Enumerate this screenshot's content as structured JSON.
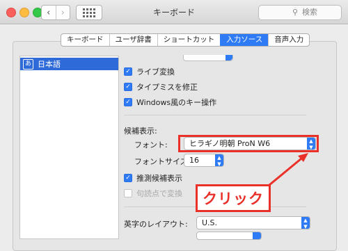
{
  "window": {
    "title": "キーボード",
    "back_glyph": "‹",
    "forward_glyph": "›",
    "search_placeholder": "検索",
    "search_icon_glyph": "⚲"
  },
  "tabs": [
    {
      "label": "キーボード",
      "active": false
    },
    {
      "label": "ユーザ辞書",
      "active": false
    },
    {
      "label": "ショートカット",
      "active": false
    },
    {
      "label": "入力ソース",
      "active": true
    },
    {
      "label": "音声入力",
      "active": false
    }
  ],
  "sidebar": {
    "items": [
      {
        "icon_text": "あ",
        "label": "日本語",
        "selected": true
      }
    ]
  },
  "options": {
    "live_conversion": {
      "label": "ライブ変換",
      "checked": true
    },
    "typo_correction": {
      "label": "タイプミスを修正",
      "checked": true
    },
    "windows_keys": {
      "label": "Windows風のキー操作",
      "checked": true
    },
    "candidates_heading": "候補表示:",
    "font_label": "フォント:",
    "font_value": "ヒラギノ明朝 ProN W6",
    "font_size_label": "フォントサイズ:",
    "font_size_value": "16",
    "show_suggestions": {
      "label": "推測候補表示",
      "checked": true
    },
    "punct_conversion": {
      "label": "句読点で変換",
      "checked": false,
      "disabled": true
    },
    "english_layout_label": "英字のレイアウト:",
    "english_layout_value": "U.S."
  },
  "annotation": {
    "callout_text": "クリック",
    "color": "#e9312a"
  },
  "check_glyph": "✓",
  "colors": {
    "accent": "#2f7bf6",
    "selection": "#2f6ad9",
    "annotation": "#e9312a"
  }
}
